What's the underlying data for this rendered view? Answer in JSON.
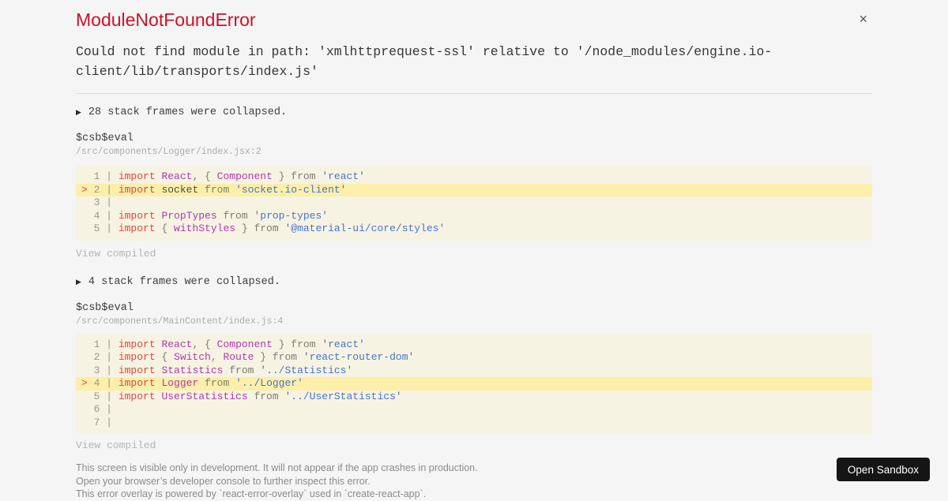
{
  "colors": {
    "page_bg": "#f5f5f5",
    "title_red": "#ce1126",
    "keyword_red": "#e2453e",
    "identifier_purple": "#b138af",
    "string_blue": "#4673cf",
    "code_bg": "#f7f3e3",
    "highlight_bg": "#fbefa9",
    "button_bg": "#151515"
  },
  "header": {
    "title": "ModuleNotFoundError",
    "close_icon": "×",
    "message": "Could not find module in path: 'xmlhttprequest-ssl' relative to '/node_modules/engine.io-client/lib/transports/index.js'"
  },
  "sections": [
    {
      "collapse_arrow": "▶",
      "collapsed_note": "28 stack frames were collapsed.",
      "frame_fn": "$csb$eval",
      "frame_path": "/src/components/Logger/index.jsx:2",
      "view_compiled": "View compiled",
      "code": [
        {
          "h": false,
          "t": [
            [
              "ln",
              "  1 | "
            ],
            [
              "kw",
              "import"
            ],
            [
              "pl",
              " "
            ],
            [
              "id",
              "React"
            ],
            [
              "op",
              ", { "
            ],
            [
              "id",
              "Component"
            ],
            [
              "op",
              " } from "
            ],
            [
              "str",
              "'react'"
            ]
          ]
        },
        {
          "h": true,
          "t": [
            [
              "mk",
              "> "
            ],
            [
              "ln",
              "2 | "
            ],
            [
              "kw",
              "import"
            ],
            [
              "pl",
              " socket"
            ],
            [
              "op",
              " from "
            ],
            [
              "str",
              "'socket.io-client'"
            ]
          ]
        },
        {
          "h": false,
          "t": [
            [
              "ln",
              "  3 | "
            ]
          ]
        },
        {
          "h": false,
          "t": [
            [
              "ln",
              "  4 | "
            ],
            [
              "kw",
              "import"
            ],
            [
              "pl",
              " "
            ],
            [
              "id",
              "PropTypes"
            ],
            [
              "op",
              " from "
            ],
            [
              "str",
              "'prop-types'"
            ]
          ]
        },
        {
          "h": false,
          "t": [
            [
              "ln",
              "  5 | "
            ],
            [
              "kw",
              "import"
            ],
            [
              "op",
              " { "
            ],
            [
              "id",
              "withStyles"
            ],
            [
              "op",
              " } from "
            ],
            [
              "str",
              "'@material-ui/core/styles'"
            ]
          ]
        }
      ]
    },
    {
      "collapse_arrow": "▶",
      "collapsed_note": "4 stack frames were collapsed.",
      "frame_fn": "$csb$eval",
      "frame_path": "/src/components/MainContent/index.js:4",
      "view_compiled": "View compiled",
      "code": [
        {
          "h": false,
          "t": [
            [
              "ln",
              "  1 | "
            ],
            [
              "kw",
              "import"
            ],
            [
              "pl",
              " "
            ],
            [
              "id",
              "React"
            ],
            [
              "op",
              ", { "
            ],
            [
              "id",
              "Component"
            ],
            [
              "op",
              " } from "
            ],
            [
              "str",
              "'react'"
            ]
          ]
        },
        {
          "h": false,
          "t": [
            [
              "ln",
              "  2 | "
            ],
            [
              "kw",
              "import"
            ],
            [
              "op",
              " { "
            ],
            [
              "id",
              "Switch"
            ],
            [
              "op",
              ", "
            ],
            [
              "id",
              "Route"
            ],
            [
              "op",
              " } from "
            ],
            [
              "str",
              "'react-router-dom'"
            ]
          ]
        },
        {
          "h": false,
          "t": [
            [
              "ln",
              "  3 | "
            ],
            [
              "kw",
              "import"
            ],
            [
              "pl",
              " "
            ],
            [
              "id",
              "Statistics"
            ],
            [
              "op",
              " from "
            ],
            [
              "str",
              "'../Statistics'"
            ]
          ]
        },
        {
          "h": true,
          "t": [
            [
              "mk",
              "> "
            ],
            [
              "ln",
              "4 | "
            ],
            [
              "kw",
              "import"
            ],
            [
              "pl",
              " "
            ],
            [
              "id",
              "Logger"
            ],
            [
              "op",
              " from "
            ],
            [
              "str",
              "'../Logger'"
            ]
          ]
        },
        {
          "h": false,
          "t": [
            [
              "ln",
              "  5 | "
            ],
            [
              "kw",
              "import"
            ],
            [
              "pl",
              " "
            ],
            [
              "id",
              "UserStatistics"
            ],
            [
              "op",
              " from "
            ],
            [
              "str",
              "'../UserStatistics'"
            ]
          ]
        },
        {
          "h": false,
          "t": [
            [
              "ln",
              "  6 | "
            ]
          ]
        },
        {
          "h": false,
          "t": [
            [
              "ln",
              "  7 | "
            ]
          ]
        }
      ]
    }
  ],
  "footer": {
    "lines": [
      "This screen is visible only in development. It will not appear if the app crashes in production.",
      "Open your browser’s developer console to further inspect this error.",
      "This error overlay is powered by `react-error-overlay` used in `create-react-app`."
    ]
  },
  "sandbox_button": {
    "label": "Open Sandbox"
  }
}
